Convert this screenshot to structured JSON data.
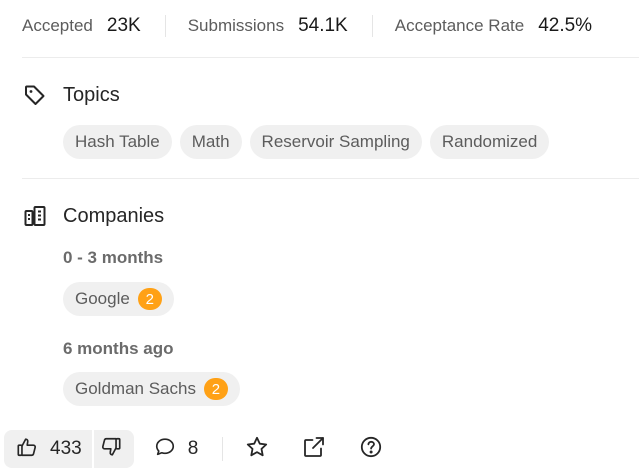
{
  "stats": {
    "accepted_label": "Accepted",
    "accepted_value": "23K",
    "submissions_label": "Submissions",
    "submissions_value": "54.1K",
    "acceptance_rate_label": "Acceptance Rate",
    "acceptance_rate_value": "42.5%"
  },
  "topics": {
    "title": "Topics",
    "icon": "tag-icon",
    "tags": [
      "Hash Table",
      "Math",
      "Reservoir Sampling",
      "Randomized"
    ]
  },
  "companies": {
    "title": "Companies",
    "icon": "building-icon",
    "groups": [
      {
        "period": "0 - 3 months",
        "items": [
          {
            "name": "Google",
            "count": "2"
          }
        ]
      },
      {
        "period": "6 months ago",
        "items": [
          {
            "name": "Goldman Sachs",
            "count": "2"
          }
        ]
      }
    ]
  },
  "footer": {
    "likes": "433",
    "comments": "8",
    "icons": [
      "thumbs-up-icon",
      "thumbs-down-icon",
      "comment-icon",
      "star-icon",
      "share-icon",
      "help-icon"
    ]
  },
  "colors": {
    "accent": "#ffa116",
    "chip_bg": "#f0f0f0",
    "divider": "#ececec"
  }
}
